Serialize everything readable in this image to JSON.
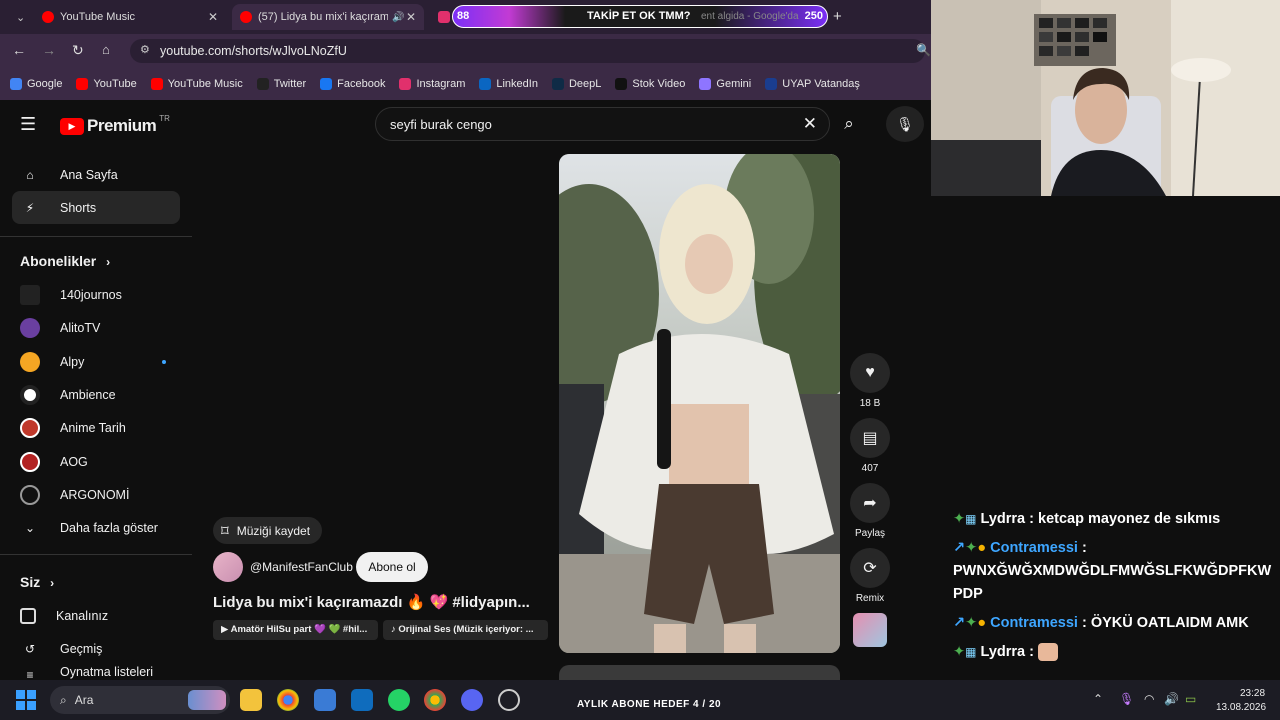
{
  "browser": {
    "tabs": [
      {
        "label": "YouTube Music",
        "close": "✕"
      },
      {
        "label": "(57) Lidya bu mix'i kaçırama",
        "close": "✕"
      }
    ],
    "url": "youtube.com/shorts/wJlvoLNoZfU",
    "bookmarks": [
      {
        "label": "Google",
        "color": "#4285f4"
      },
      {
        "label": "YouTube",
        "color": "#ff0000"
      },
      {
        "label": "YouTube Music",
        "color": "#ff0000"
      },
      {
        "label": "Twitter",
        "color": "#222222"
      },
      {
        "label": "Facebook",
        "color": "#1877f2"
      },
      {
        "label": "Instagram",
        "color": "#e1306c"
      },
      {
        "label": "LinkedIn",
        "color": "#0a66c2"
      },
      {
        "label": "DeepL",
        "color": "#0f2b46"
      },
      {
        "label": "Stok Video",
        "color": "#111111"
      },
      {
        "label": "Gemini",
        "color": "#8e75ff"
      },
      {
        "label": "UYAP Vatandaş",
        "color": "#1a3d8f"
      }
    ],
    "overlay": {
      "left_count": "88",
      "text": "TAKİP ET OK TMM?",
      "right_count": "250",
      "faded_tab": "ent algida - Google'da"
    }
  },
  "youtube": {
    "logo": "Premium",
    "region": "TR",
    "search_value": "seyfi burak cengo",
    "sidebar": {
      "home": "Ana Sayfa",
      "shorts": "Shorts",
      "subs_title": "Abonelikler",
      "subs": [
        "140journos",
        "AlitoTV",
        "Alpy",
        "Ambience",
        "Anime Tarih",
        "AOG",
        "ARGONOMİ"
      ],
      "more": "Daha fazla göster",
      "you_title": "Siz",
      "you_items": [
        "Kanalınız",
        "Geçmiş",
        "Oynatma listeleri"
      ]
    },
    "short": {
      "save_music": "Müziği kaydet",
      "channel": "@ManifestFanClub",
      "subscribe": "Abone ol",
      "title": "Lidya bu mix'i kaçıramazdı 🔥 💖 #lidyapın...",
      "chip1": "▶ Amatör HilSu part 💜 💚 #hil...",
      "chip2": "♪ Orijinal Ses (Müzik içeriyor: ..."
    },
    "actions": {
      "likes": "18 B",
      "comments": "407",
      "share": "Paylaş",
      "remix": "Remix"
    }
  },
  "chat": [
    {
      "user": "Lydrra",
      "sep": " : ",
      "msg": "ketcap mayonez de sıkmıs",
      "user_color": "#ffffff"
    },
    {
      "user": "Contramessi",
      "sep": " : ",
      "msg": "PWNXĞWĞXMDWĞDLFMWĞSLFKWĞDPFKWPDP",
      "user_color": "#3ea6ff"
    },
    {
      "user": "Contramessi",
      "sep": " : ",
      "msg": "ÖYKÜ OATLAIDM AMK",
      "user_color": "#3ea6ff"
    },
    {
      "user": "Lydrra",
      "sep": " : ",
      "msg": "",
      "user_color": "#ffffff"
    }
  ],
  "taskbar": {
    "search": "Ara",
    "goal": "AYLIK ABONE HEDEF 4 / 20",
    "time": "23:28",
    "date": "13.08.2026"
  }
}
